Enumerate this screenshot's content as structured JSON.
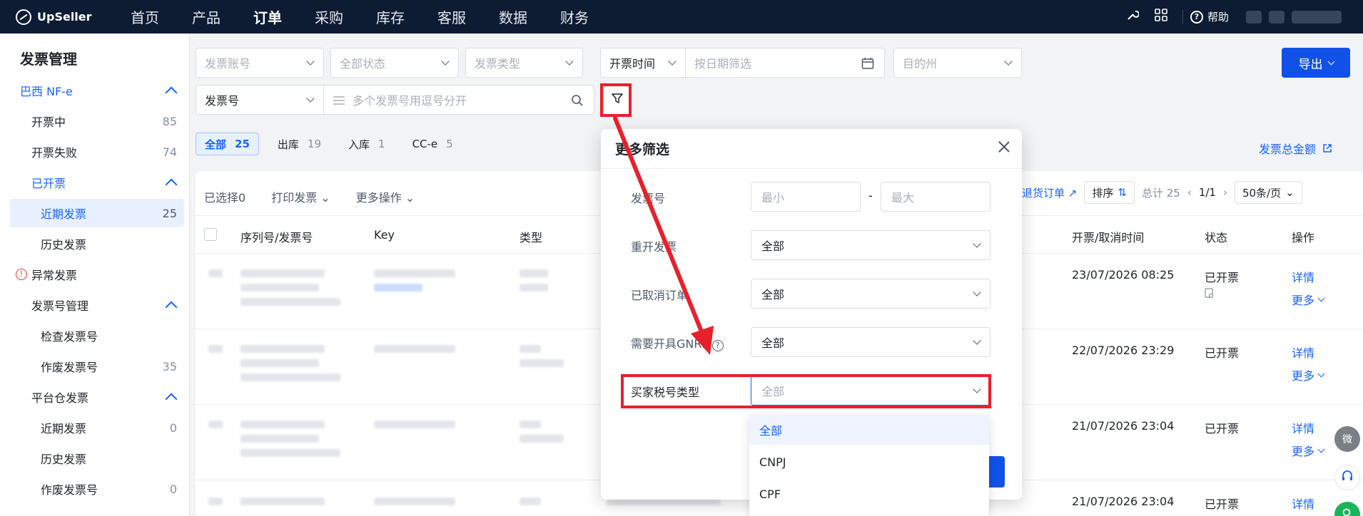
{
  "topbar": {
    "brand": "UpSeller",
    "nav": [
      "首页",
      "产品",
      "订单",
      "采购",
      "库存",
      "客服",
      "数据",
      "财务"
    ],
    "active_nav": "订单",
    "help_label": "帮助"
  },
  "sidebar": {
    "title": "发票管理",
    "items": [
      {
        "label": "巴西 NF-e",
        "count": "",
        "type": "group"
      },
      {
        "label": "开票中",
        "count": "85",
        "type": "item"
      },
      {
        "label": "开票失败",
        "count": "74",
        "type": "item"
      },
      {
        "label": "已开票",
        "count": "",
        "type": "group"
      },
      {
        "label": "近期发票",
        "count": "25",
        "type": "selected"
      },
      {
        "label": "历史发票",
        "count": "",
        "type": "sub"
      },
      {
        "label": "异常发票",
        "count": "",
        "type": "warn"
      },
      {
        "label": "发票号管理",
        "count": "",
        "type": "group2"
      },
      {
        "label": "检查发票号",
        "count": "",
        "type": "sub"
      },
      {
        "label": "作废发票号",
        "count": "35",
        "type": "sub"
      },
      {
        "label": "平台仓发票",
        "count": "",
        "type": "group2"
      },
      {
        "label": "近期发票",
        "count": "0",
        "type": "sub"
      },
      {
        "label": "历史发票",
        "count": "",
        "type": "sub"
      },
      {
        "label": "作废发票号",
        "count": "0",
        "type": "sub"
      }
    ]
  },
  "filters": {
    "account": "发票账号",
    "status": "全部状态",
    "type": "发票类型",
    "time_mode": "开票时间",
    "date_placeholder": "按日期筛选",
    "state": "目的州",
    "search_type": "发票号",
    "search_placeholder": "多个发票号用逗号分开",
    "export": "导出"
  },
  "tabs": [
    {
      "label": "全部",
      "count": "25"
    },
    {
      "label": "出库",
      "count": "19"
    },
    {
      "label": "入库",
      "count": "1"
    },
    {
      "label": "CC-e",
      "count": "5"
    }
  ],
  "total_link": "发票总金额",
  "toolbar": {
    "selected": "已选择0",
    "print": "打印发票",
    "more_ops": "更多操作",
    "return_order": "退货订单",
    "sort": "排序",
    "total": "总计 25",
    "page": "1/1",
    "page_size": "50条/页"
  },
  "table": {
    "headers": [
      "序列号/发票号",
      "Key",
      "类型",
      "开票/取消时间",
      "状态",
      "操作"
    ],
    "rows": [
      {
        "time": "23/07/2026 08:25",
        "status": "已开票",
        "detail": "详情",
        "more": "更多"
      },
      {
        "time": "22/07/2026 23:29",
        "status": "已开票",
        "detail": "详情",
        "more": "更多"
      },
      {
        "time": "21/07/2026 23:04",
        "status": "已开票",
        "detail": "详情",
        "more": "更多"
      },
      {
        "time": "21/07/2026 23:04",
        "status": "已开票",
        "detail": "详情",
        "more": ""
      }
    ]
  },
  "modal": {
    "title": "更多筛选",
    "invoice_no_label": "发票号",
    "min_placeholder": "最小",
    "max_placeholder": "最大",
    "range_sep": "-",
    "reissue_label": "重开发票",
    "reissue_value": "全部",
    "cancelled_label": "已取消订单",
    "cancelled_value": "全部",
    "gnre_label": "需要开具GNRE",
    "gnre_value": "全部",
    "buyer_tax_label": "买家税号类型",
    "buyer_tax_value": "全部",
    "options": [
      "全部",
      "CNPJ",
      "CPF"
    ]
  },
  "float": {
    "wechat": "微"
  },
  "colors": {
    "primary": "#1151e8",
    "highlight": "#e8202a",
    "nav_bg": "#0d1b33"
  }
}
